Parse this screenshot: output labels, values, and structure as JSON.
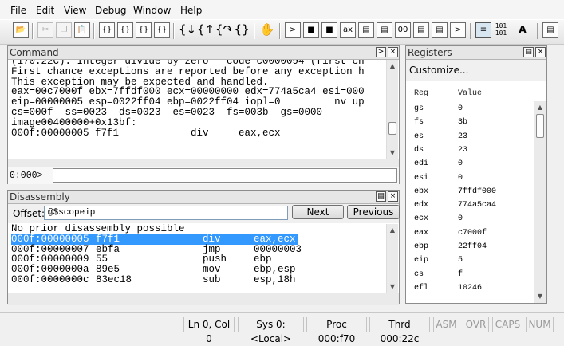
{
  "menu": [
    "File",
    "Edit",
    "View",
    "Debug",
    "Window",
    "Help"
  ],
  "toolbar": {
    "icons": [
      "open-icon",
      "cut-icon",
      "copy-icon",
      "paste-icon",
      "step-into-icon",
      "step-over-icon",
      "step-out-icon",
      "run-to-cursor-icon",
      "go-icon",
      "restart-icon",
      "break-icon",
      "stop-icon",
      "hand-icon",
      "command-window-icon",
      "watch-window-icon",
      "locals-window-icon",
      "registers-window-icon",
      "memory-window-icon",
      "call-stack-icon",
      "disassembly-window-icon",
      "scratch-pad-icon",
      "source-mode-icon",
      "hex-mode-icon",
      "font-icon",
      "options-icon"
    ],
    "glyphs": {
      "font": "A A",
      "hex": "101 101",
      "source": "≡"
    }
  },
  "command": {
    "title": "Command",
    "lines": [
      "(170.22C): Integer divide-by-zero - code c0000094 (first ch",
      "First chance exceptions are reported before any exception h",
      "This exception may be expected and handled.",
      "eax=00c7000f ebx=7ffdf000 ecx=00000000 edx=774a5ca4 esi=000",
      "eip=00000005 esp=0022ff04 ebp=0022ff04 iopl=0         nv up",
      "cs=000f  ss=0023  ds=0023  es=0023  fs=003b  gs=0000",
      "image00400000+0x13bf:",
      "000f:00000005 f7f1            div     eax,ecx"
    ],
    "prompt": "0:000>",
    "input_value": ""
  },
  "disassembly": {
    "title": "Disassembly",
    "offset_label": "Offset:",
    "offset_value": "@$scopeip",
    "next_label": "Next",
    "previous_label": "Previous",
    "lines": [
      {
        "addr": "No prior disassembly possible",
        "bytes": "",
        "op": "",
        "args": "",
        "selected": false
      },
      {
        "addr": "000f:00000005",
        "bytes": "f7f1",
        "op": "div",
        "args": "eax,ecx",
        "selected": true
      },
      {
        "addr": "000f:00000007",
        "bytes": "ebfa",
        "op": "jmp",
        "args": "00000003",
        "selected": false
      },
      {
        "addr": "000f:00000009",
        "bytes": "55",
        "op": "push",
        "args": "ebp",
        "selected": false
      },
      {
        "addr": "000f:0000000a",
        "bytes": "89e5",
        "op": "mov",
        "args": "ebp,esp",
        "selected": false
      },
      {
        "addr": "000f:0000000c",
        "bytes": "83ec18",
        "op": "sub",
        "args": "esp,18h",
        "selected": false
      }
    ]
  },
  "registers": {
    "title": "Registers",
    "customize": "Customize...",
    "col_reg": "Reg",
    "col_value": "Value",
    "rows": [
      {
        "reg": "gs",
        "value": "0"
      },
      {
        "reg": "fs",
        "value": "3b"
      },
      {
        "reg": "es",
        "value": "23"
      },
      {
        "reg": "ds",
        "value": "23"
      },
      {
        "reg": "edi",
        "value": "0"
      },
      {
        "reg": "esi",
        "value": "0"
      },
      {
        "reg": "ebx",
        "value": "7ffdf000"
      },
      {
        "reg": "edx",
        "value": "774a5ca4"
      },
      {
        "reg": "ecx",
        "value": "0"
      },
      {
        "reg": "eax",
        "value": "c7000f"
      },
      {
        "reg": "ebp",
        "value": "22ff04"
      },
      {
        "reg": "eip",
        "value": "5"
      },
      {
        "reg": "cs",
        "value": "f"
      },
      {
        "reg": "efl",
        "value": "10246"
      }
    ]
  },
  "status": {
    "position": "Ln 0, Col 0",
    "system": "Sys 0:<Local>",
    "process": "Proc 000:f70",
    "thread": "Thrd 000:22c",
    "asm": "ASM",
    "ovr": "OVR",
    "caps": "CAPS",
    "num": "NUM"
  },
  "colors": {
    "selection": "#3399ff",
    "selection_text": "#ffffff",
    "pane_border": "#8c8c8c"
  }
}
